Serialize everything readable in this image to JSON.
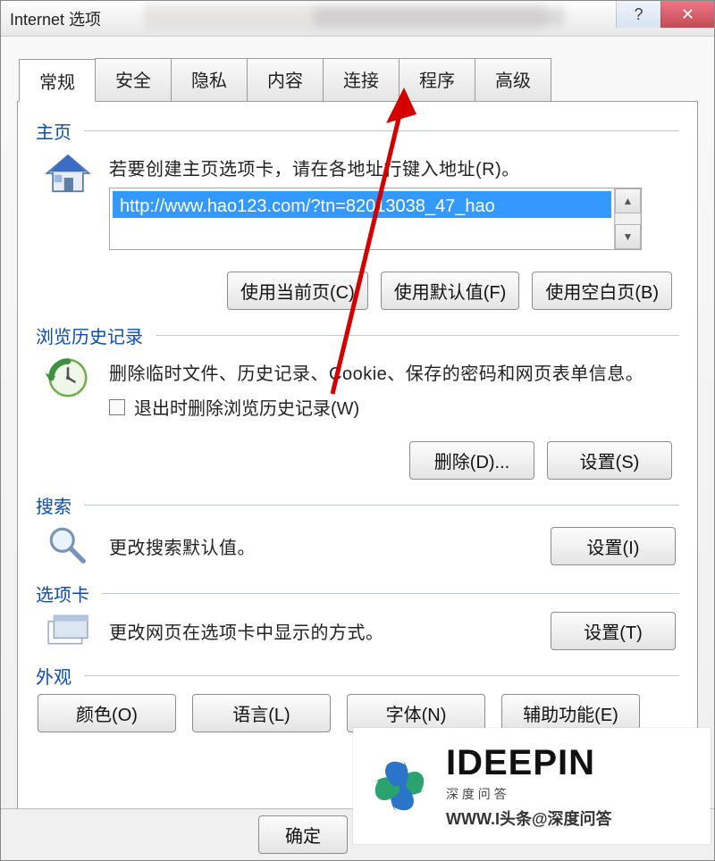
{
  "window": {
    "title": "Internet 选项"
  },
  "tabs": {
    "general": "常规",
    "security": "安全",
    "privacy": "隐私",
    "content": "内容",
    "connections": "连接",
    "programs": "程序",
    "advanced": "高级"
  },
  "home": {
    "title": "主页",
    "instruction": "若要创建主页选项卡，请在各地址行键入地址(R)。",
    "url": "http://www.hao123.com/?tn=82013038_47_hao",
    "use_current": "使用当前页(C)",
    "use_default": "使用默认值(F)",
    "use_blank": "使用空白页(B)"
  },
  "history": {
    "title": "浏览历史记录",
    "instruction": "删除临时文件、历史记录、Cookie、保存的密码和网页表单信息。",
    "checkbox_label": "退出时删除浏览历史记录(W)",
    "delete_btn": "删除(D)...",
    "settings_btn": "设置(S)"
  },
  "search": {
    "title": "搜索",
    "instruction": "更改搜索默认值。",
    "settings_btn": "设置(I)"
  },
  "tabs_section": {
    "title": "选项卡",
    "instruction": "更改网页在选项卡中显示的方式。",
    "settings_btn": "设置(T)"
  },
  "appearance": {
    "title": "外观",
    "colors": "颜色(O)",
    "languages": "语言(L)",
    "fonts": "字体(N)",
    "accessibility": "辅助功能(E)"
  },
  "footer": {
    "ok": "确定"
  },
  "watermark": {
    "brand": "IDEEPIN",
    "sub": "深    度    问    答",
    "url": "WWW.I头条@深度问答"
  }
}
